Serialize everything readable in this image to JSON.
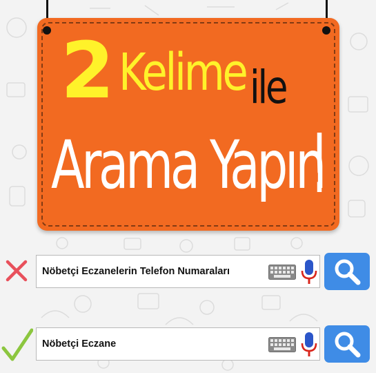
{
  "sign": {
    "line1_number": "2",
    "line1_word": "Kelime",
    "line1_suffix": "ile",
    "line2": "Arama Yapın",
    "exclamation": "!"
  },
  "searches": [
    {
      "status_icon": "cross-icon",
      "text": "Nöbetçi Eczanelerin Telefon Numaraları"
    },
    {
      "status_icon": "check-icon",
      "text": "Nöbetçi Eczane"
    }
  ],
  "colors": {
    "sign_orange": "#f26a21",
    "headline_yellow": "#fff22a",
    "cross_red": "#e8505b",
    "check_green": "#8cc63f",
    "search_button_blue": "#3f8ce6",
    "mic_blue": "#2b56c9",
    "mic_red": "#d9261c"
  }
}
